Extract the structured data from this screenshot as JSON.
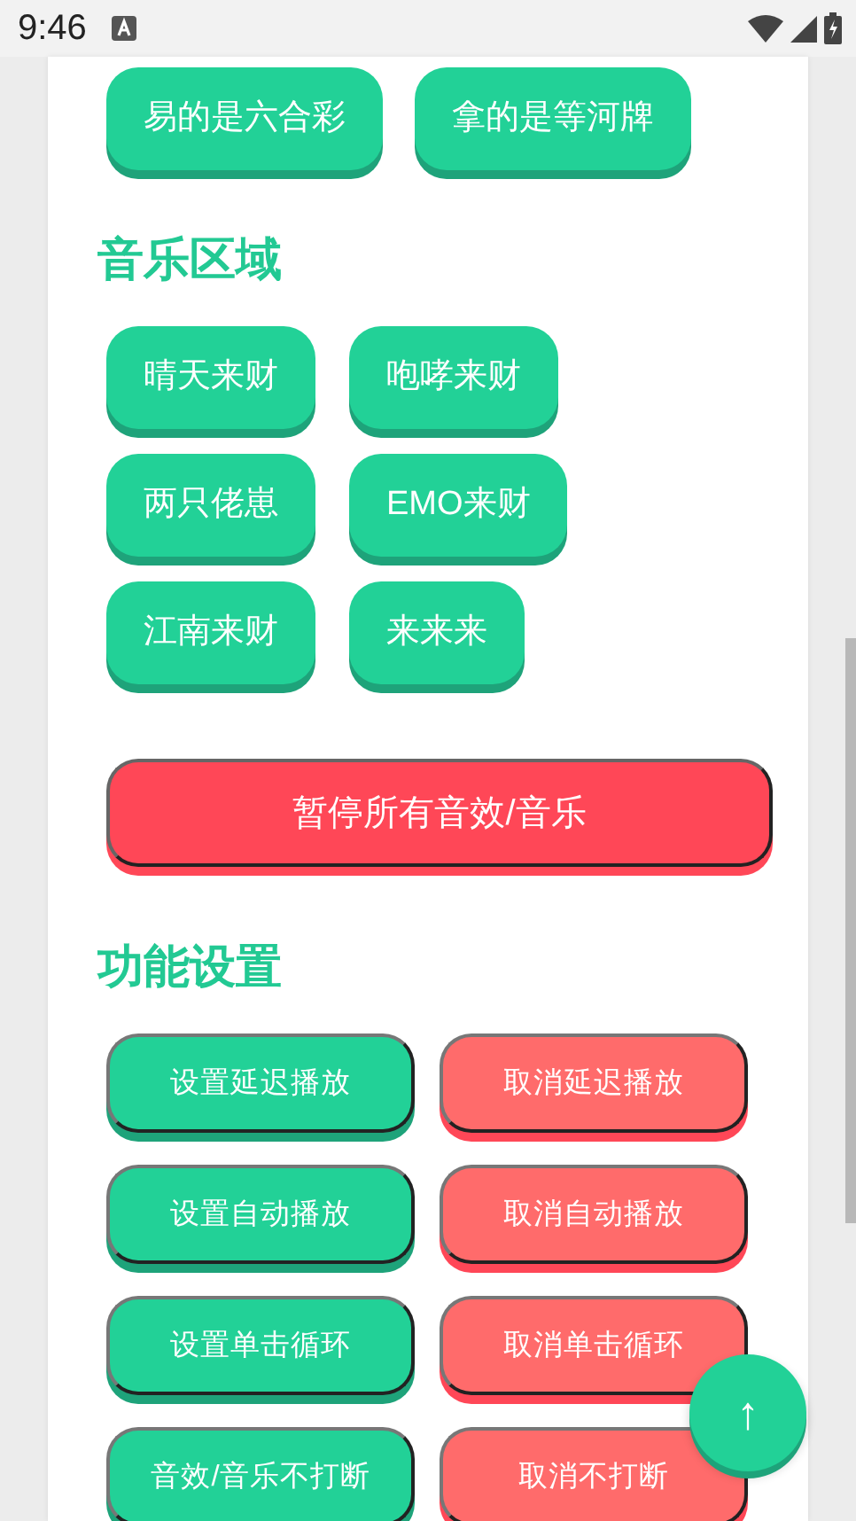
{
  "status_bar": {
    "time": "9:46"
  },
  "top_buttons": [
    {
      "label": "易的是六合彩"
    },
    {
      "label": "拿的是等河牌"
    }
  ],
  "music": {
    "title": "音乐区域",
    "buttons": [
      {
        "label": "晴天来财"
      },
      {
        "label": "咆哮来财"
      },
      {
        "label": "两只佬崽"
      },
      {
        "label": "EMO来财"
      },
      {
        "label": "江南来财"
      },
      {
        "label": "来来来"
      }
    ]
  },
  "stop_all_button": {
    "label": "暂停所有音效/音乐"
  },
  "settings": {
    "title": "功能设置",
    "buttons": [
      {
        "label": "设置延迟播放",
        "kind": "set"
      },
      {
        "label": "取消延迟播放",
        "kind": "cancel"
      },
      {
        "label": "设置自动播放",
        "kind": "set"
      },
      {
        "label": "取消自动播放",
        "kind": "cancel"
      },
      {
        "label": "设置单击循环",
        "kind": "set"
      },
      {
        "label": "取消单击循环",
        "kind": "cancel"
      },
      {
        "label": "音效/音乐不打断",
        "kind": "set"
      },
      {
        "label": "取消不打断",
        "kind": "cancel"
      }
    ]
  },
  "scroll_top_button": {
    "label": "↑"
  }
}
